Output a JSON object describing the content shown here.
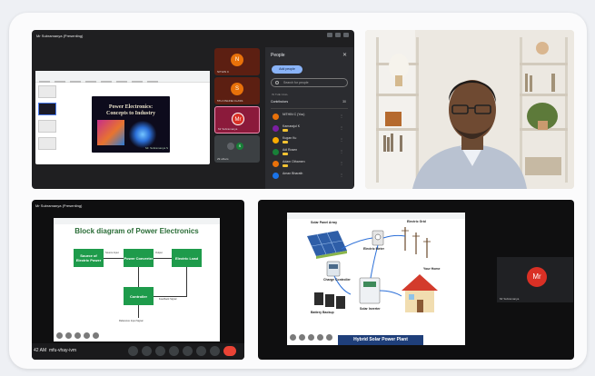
{
  "top_left": {
    "meeting_title": "Mr Subramanya (Presenting)",
    "slide_title": "Power Electronics: Concepts to Industry",
    "slide_footer": "Mr. Subramanya S",
    "tiles": [
      {
        "initial": "N",
        "name": "NITHIN C",
        "color": "#e8710a"
      },
      {
        "initial": "S",
        "name": "5TH ONLINE CLASS",
        "color": "#e8710a"
      },
      {
        "initial": "Mr",
        "name": "Mr Subramanya",
        "color": "#d93025"
      },
      {
        "initial": "",
        "name": "29 others",
        "color": "#5f6368"
      }
    ],
    "people_panel": {
      "title": "People",
      "add_button": "Add people",
      "search_placeholder": "Search for people",
      "section_label": "IN THE CALL",
      "contributors_label": "Contributors",
      "contributors_count": "30",
      "participants": [
        {
          "name": "NITHIN C (You)",
          "color": "#e8710a"
        },
        {
          "name": "Kamarajul K",
          "color": "#7b1fa2"
        },
        {
          "name": "Kugan Ku",
          "color": "#f9ab00"
        },
        {
          "name": "Adi Rosen",
          "color": "#188038"
        },
        {
          "name": "Adam Othamen",
          "color": "#e8710a"
        },
        {
          "name": "Aman Bharath",
          "color": "#1a73e8"
        }
      ]
    }
  },
  "bottom_left": {
    "meeting_title": "Mr Subramanya (Presenting)",
    "diagram_title": "Block diagram of Power Electronics",
    "blocks": [
      "Source of Electric Power",
      "Power Converter",
      "Electric Load",
      "Controller"
    ],
    "labels": [
      "Source Input",
      "Output",
      "Feedback Signal",
      "Reference Input Signal"
    ],
    "time": "42 AM",
    "meeting_code": "mfu-vhay-ivm"
  },
  "bottom_right": {
    "diagram_title": "Hybrid Solar Power Plant",
    "labels": [
      "Solar Panel Array",
      "Electric Grid",
      "Electric Meter",
      "Charge Controller",
      "Battery Backup",
      "Solar Inverter",
      "Your Home"
    ],
    "self_tile": {
      "initial": "Mr",
      "name": "Mr Subramanya"
    }
  }
}
